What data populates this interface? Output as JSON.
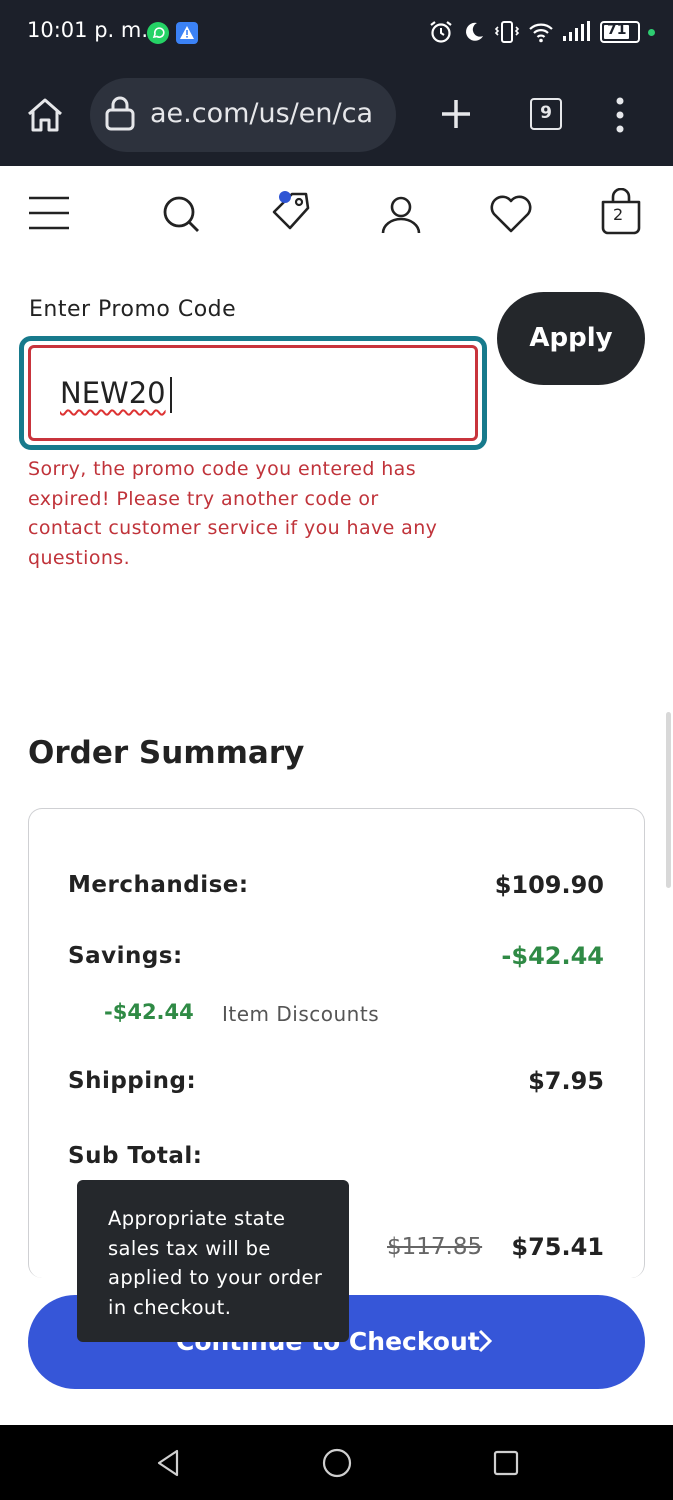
{
  "status_bar": {
    "time": "10:01 p. m.",
    "battery": "71"
  },
  "browser": {
    "url": "ae.com/us/en/ca",
    "tab_count": "9"
  },
  "nav": {
    "cart_count": "2"
  },
  "promo": {
    "label": "Enter Promo Code",
    "value": "NEW20",
    "apply_label": "Apply",
    "error_message": "Sorry, the promo code you entered has expired! Please try another code or contact customer service if you have any questions."
  },
  "order_summary": {
    "title": "Order Summary",
    "merchandise_label": "Merchandise:",
    "merchandise_value": "$109.90",
    "savings_label": "Savings:",
    "savings_value": "-$42.44",
    "discount_amount": "-$42.44",
    "discount_label": "Item Discounts",
    "shipping_label": "Shipping:",
    "shipping_value": "$7.95",
    "subtotal_label": "Sub Total:",
    "subtotal_old": "$117.85",
    "subtotal_value": "$75.41"
  },
  "tooltip": {
    "text": "Appropriate state sales tax will be applied to your order in checkout."
  },
  "checkout": {
    "label": "Continue to Checkout"
  },
  "colors": {
    "primary_button": "#3656d8",
    "error": "#c0333a",
    "savings": "#2f8a45",
    "focus_ring": "#177a8c",
    "browser_chrome": "#1c202a"
  }
}
